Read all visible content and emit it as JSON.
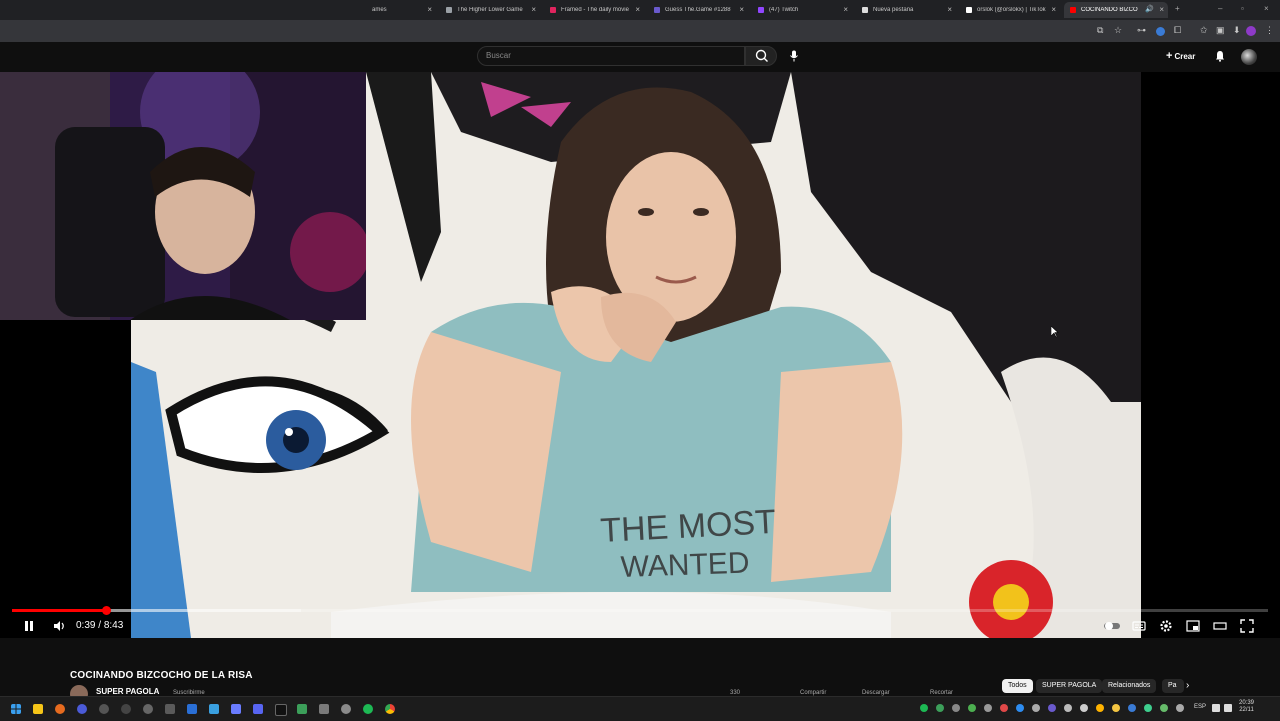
{
  "browser": {
    "tabs": [
      {
        "title": "ames",
        "favicon_color": "#9aa0a6"
      },
      {
        "title": "The Higher Lower Game",
        "favicon_color": "#9aa0a6"
      },
      {
        "title": "Framed - The daily movie",
        "favicon_color": "#e0245e"
      },
      {
        "title": "Guess The.Game #1288",
        "favicon_color": "#6a5acd"
      },
      {
        "title": "(47) Twitch",
        "favicon_color": "#9146ff"
      },
      {
        "title": "Nueva pestaña",
        "favicon_color": "#dddddd"
      },
      {
        "title": "orslok (@orslokx) | TikTok",
        "favicon_color": "#ffffff"
      },
      {
        "title": "COCINANDO BIZCO",
        "favicon_color": "#ff0000",
        "active": true
      }
    ],
    "new_tab_icon": "plus-icon"
  },
  "youtube": {
    "search_placeholder": "Buscar",
    "create_label": "Crear"
  },
  "player": {
    "time_current": "0:39",
    "time_separator": " / ",
    "time_total": "8:43",
    "progress_played": 0.075,
    "progress_loaded": 0.23
  },
  "video": {
    "title": "COCINANDO BIZCOCHO DE LA RISA",
    "channel_name": "SUPER PAGOLA",
    "subscribers": "Suscribirme",
    "shirt_line1": "THE MOST",
    "shirt_line2": "WANTED",
    "actions": [
      "330",
      "",
      "Compartir",
      "Descargar",
      "Recortar"
    ]
  },
  "chips": [
    "Todos",
    "SUPER PAGOLA",
    "Relacionados",
    "Pa"
  ],
  "taskbar": {
    "language": "ESP",
    "time": "20:39",
    "date": "22/11"
  },
  "colors": {
    "accent_red": "#ff0000",
    "page_bg": "#0f0f0f"
  }
}
